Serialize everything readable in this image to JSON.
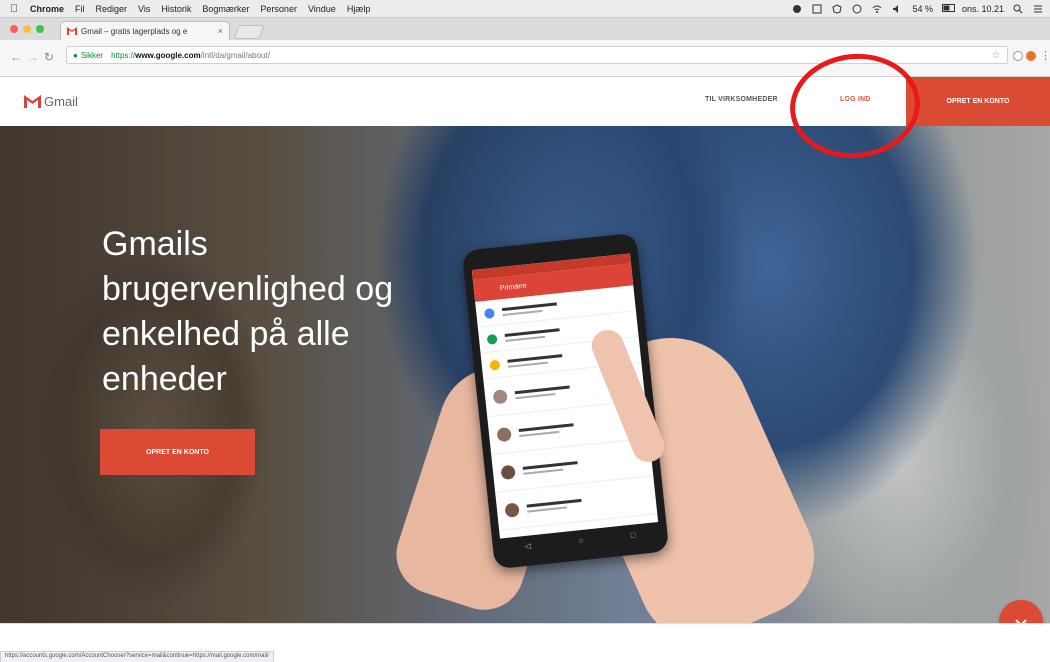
{
  "menubar": {
    "app": "Chrome",
    "items": [
      "Fil",
      "Rediger",
      "Vis",
      "Historik",
      "Bogmærker",
      "Personer",
      "Vindue",
      "Hjælp"
    ],
    "battery": "54 %",
    "clock": "ons. 10.21"
  },
  "browser": {
    "tab_title": "Gmail – gratis lagerplads og e",
    "security_label": "Sikker",
    "url_prefix": "https://",
    "url_domain": "www.google.com",
    "url_path": "/intl/da/gmail/about/",
    "hover_link": "https://accounts.google.com/AccountChooser?service=mail&continue=https://mail.google.com/mail/"
  },
  "header": {
    "logo_text": "Gmail",
    "nav_business": "TIL VIRKSOMHEDER",
    "nav_login": "LOG IND",
    "signup": "OPRET EN KONTO"
  },
  "hero": {
    "title": "Gmails brugervenlighed og enkelhed på alle enheder",
    "cta": "OPRET EN KONTO"
  },
  "phone": {
    "appbar": "Primære"
  },
  "colors": {
    "brand_red": "#db4a34",
    "annotation": "#e8191a"
  }
}
